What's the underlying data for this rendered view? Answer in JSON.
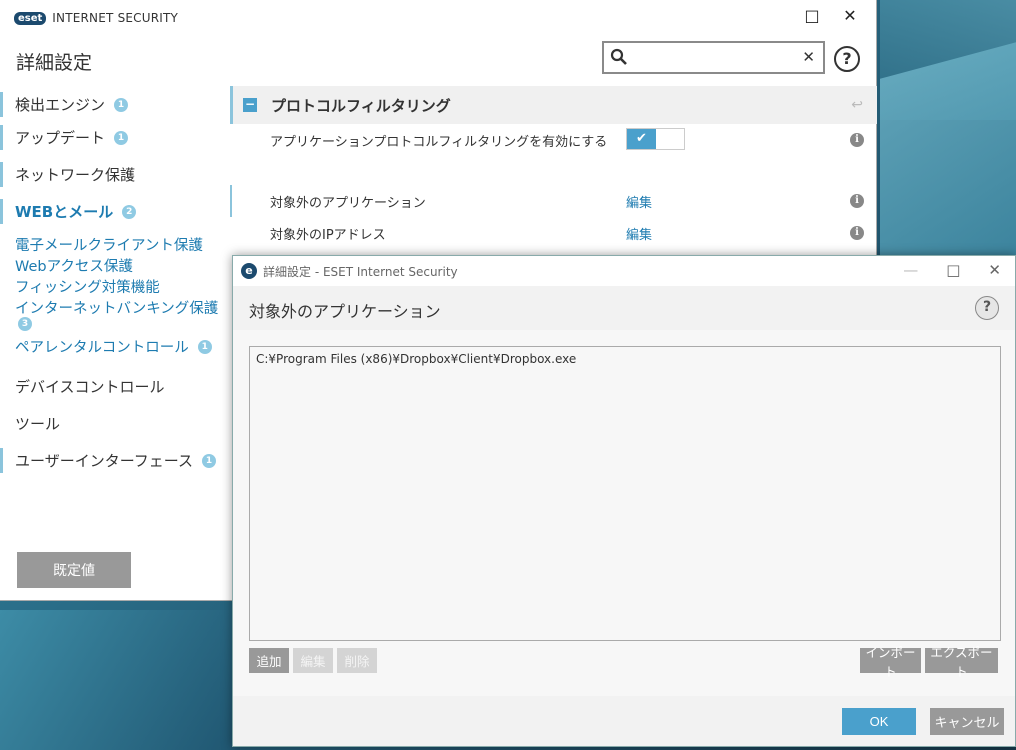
{
  "app": {
    "logo_badge": "eset",
    "logo_text": "INTERNET SECURITY",
    "minimize": "□",
    "close": "✕"
  },
  "main": {
    "title": "詳細設定",
    "search": {
      "value": "",
      "placeholder": "",
      "clear": "✕"
    },
    "help": "?"
  },
  "sidebar": {
    "items": [
      {
        "label": "検出エンジン",
        "badge": "1"
      },
      {
        "label": "アップデート",
        "badge": "1"
      },
      {
        "label": "ネットワーク保護"
      },
      {
        "label": "WEBとメール",
        "badge": "2"
      },
      {
        "label": "デバイスコントロール"
      },
      {
        "label": "ツール"
      },
      {
        "label": "ユーザーインターフェース",
        "badge": "1"
      }
    ],
    "sublinks": [
      {
        "label": "電子メールクライアント保護"
      },
      {
        "label": "Webアクセス保護"
      },
      {
        "label": "フィッシング対策機能"
      },
      {
        "label": "インターネットバンキング保護",
        "badge": "3"
      },
      {
        "label": "ペアレンタルコントロール",
        "badge": "1"
      }
    ],
    "default_button": "既定値"
  },
  "content": {
    "section_title": "プロトコルフィルタリング",
    "collapse": "−",
    "revert_icon": "↩",
    "rows": [
      {
        "label": "アプリケーションプロトコルフィルタリングを有効にする",
        "toggle": "on"
      },
      {
        "label": "対象外のアプリケーション",
        "value": "編集"
      },
      {
        "label": "対象外のIPアドレス",
        "value": "編集"
      }
    ],
    "info": "i",
    "check": "✔"
  },
  "dialog": {
    "title": "詳細設定 - ESET Internet Security",
    "logo": "e",
    "ctrls": [
      "—",
      "□",
      "✕"
    ],
    "heading": "対象外のアプリケーション",
    "help": "?",
    "list": [
      "C:¥Program Files (x86)¥Dropbox¥Client¥Dropbox.exe"
    ],
    "buttons": {
      "add": "追加",
      "edit": "編集",
      "delete": "削除",
      "import": "インポート",
      "export": "エクスポート"
    },
    "ok": "OK",
    "cancel": "キャンセル"
  }
}
